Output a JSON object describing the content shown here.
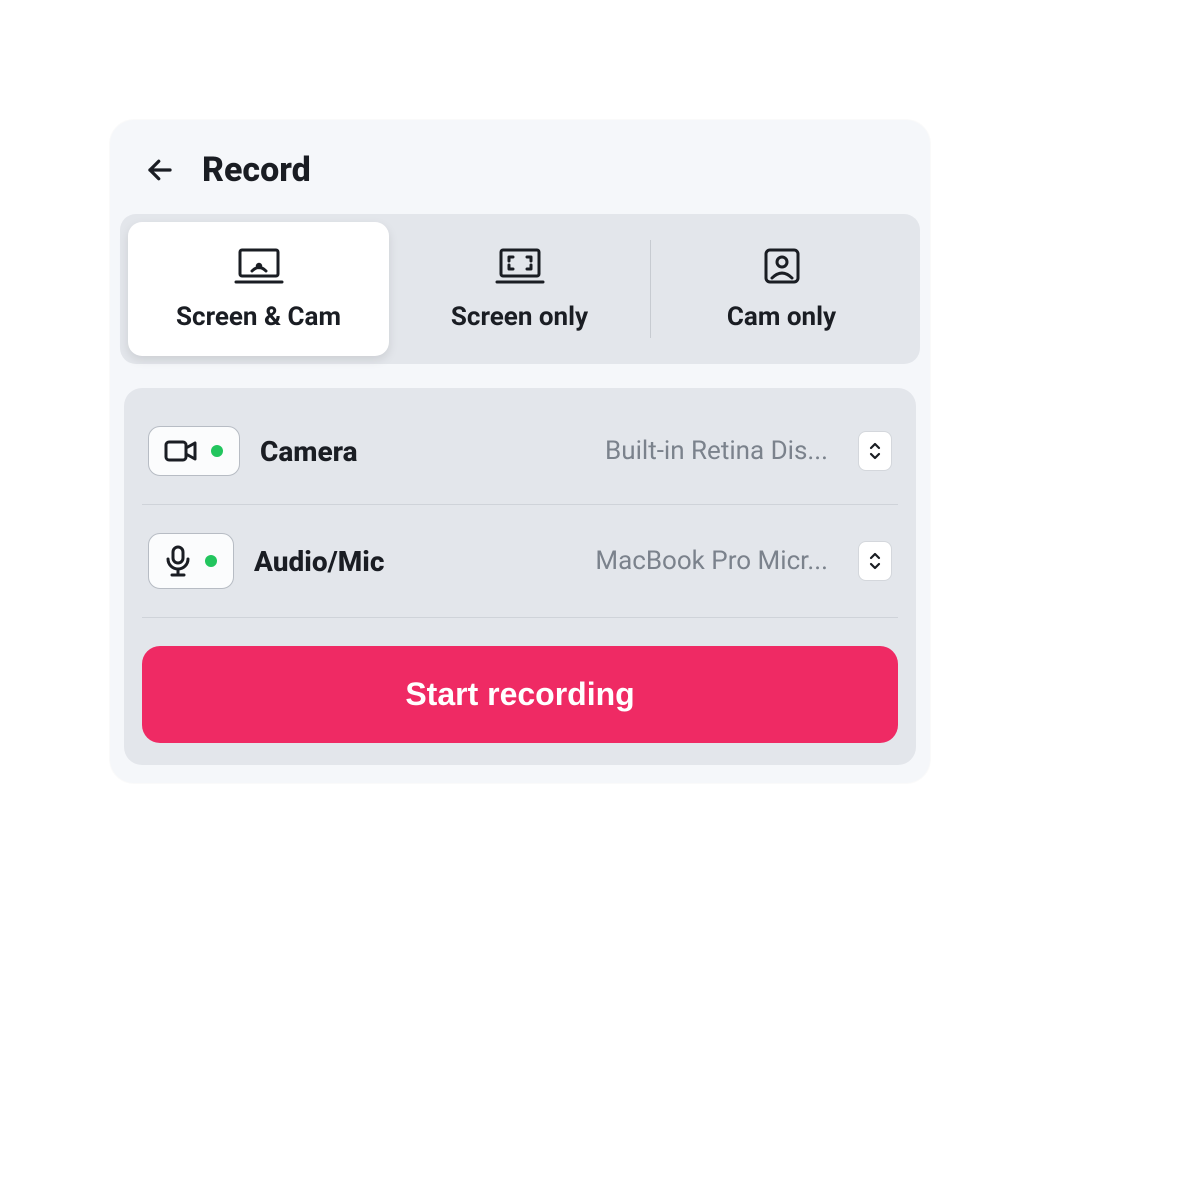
{
  "header": {
    "title": "Record"
  },
  "tabs": [
    {
      "id": "screen-cam",
      "label": "Screen & Cam",
      "active": true
    },
    {
      "id": "screen-only",
      "label": "Screen only",
      "active": false
    },
    {
      "id": "cam-only",
      "label": "Cam only",
      "active": false
    }
  ],
  "devices": {
    "camera": {
      "label": "Camera",
      "value": "Built-in Retina Dis...",
      "status": "on"
    },
    "audio": {
      "label": "Audio/Mic",
      "value": "MacBook Pro Micr...",
      "status": "on"
    }
  },
  "actions": {
    "start_label": "Start recording"
  },
  "colors": {
    "accent": "#ef2a64",
    "status_on": "#22c55e"
  }
}
